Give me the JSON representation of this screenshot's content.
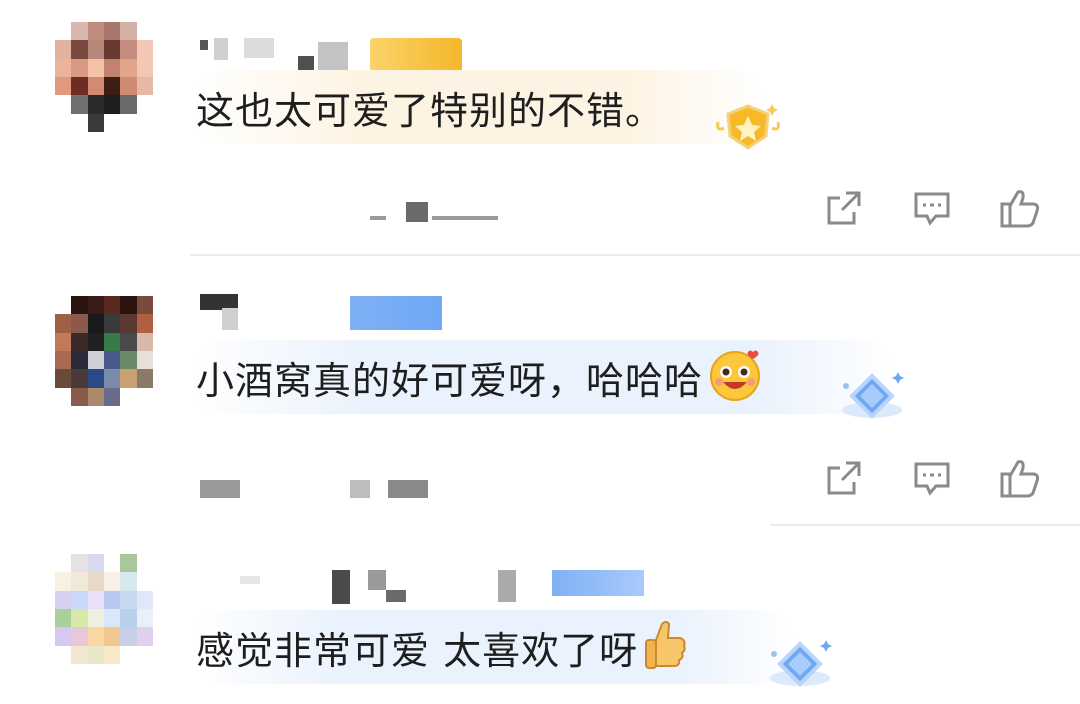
{
  "comments": [
    {
      "text": "这也太可爱了特别的不错。",
      "badge_icon": "star-shield-badge-icon"
    },
    {
      "text": "小酒窝真的好可爱呀，哈哈哈",
      "emoji_icon": "grinning-face-emoji-icon",
      "badge_icon": "diamond-badge-icon"
    },
    {
      "text": "感觉非常可爱 太喜欢了呀",
      "emoji_icon": "thumbs-up-emoji-icon",
      "badge_icon": "diamond-badge-icon"
    }
  ],
  "action_icons": [
    "share-icon",
    "reply-icon",
    "like-icon"
  ],
  "colors": {
    "gold_badge": "#f5b62a",
    "blue_badge": "#6ea8f5",
    "bubble_gold": "#fdf3e2",
    "bubble_blue": "#eaf2fd",
    "icon_gray": "#8a8a8a"
  }
}
